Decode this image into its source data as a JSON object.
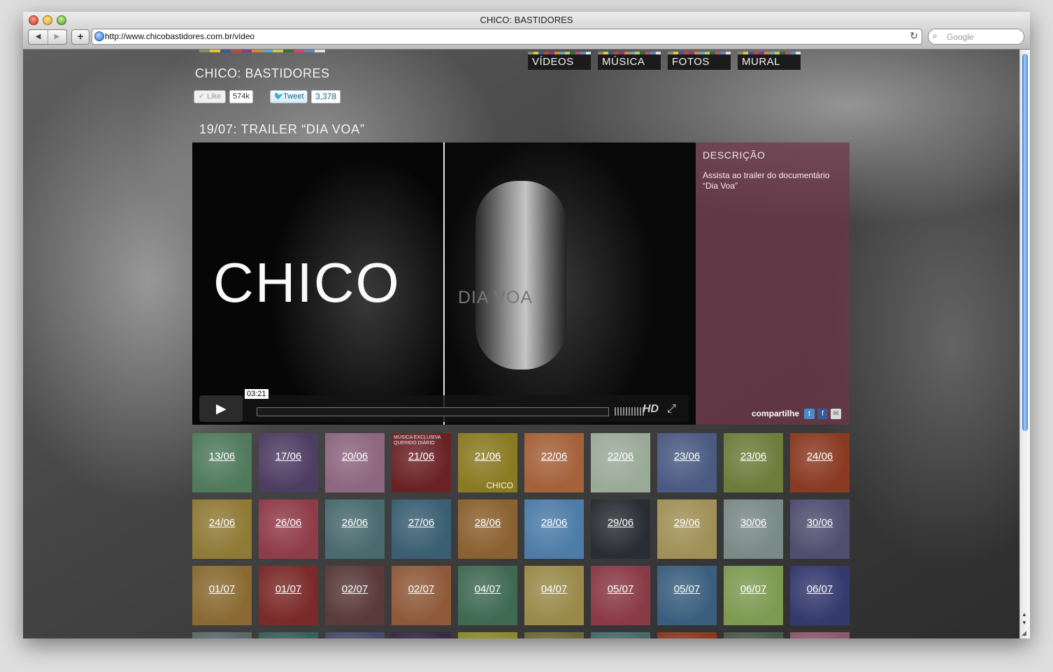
{
  "window": {
    "title": "CHICO: BASTIDORES"
  },
  "browser": {
    "url": "http://www.chicobastidores.com.br/video",
    "search_placeholder": "Google",
    "back": "◀",
    "forward": "▶",
    "add": "+",
    "reload": "↻",
    "search_icon": "⌕"
  },
  "site": {
    "title": "CHICO: BASTIDORES",
    "like_label": "✓ Like",
    "like_count": "574k",
    "tweet_label": "Tweet",
    "tweet_count": "3,378",
    "nav": [
      "VÍDEOS",
      "MÚSICA",
      "FOTOS",
      "MURAL"
    ],
    "colorbar": [
      "#8a8a6a",
      "#e6c430",
      "#3a5a9a",
      "#b84a3a",
      "#8a3a8a",
      "#d48a2a",
      "#6aa0c8",
      "#c8c84a",
      "#3a6a3a",
      "#c84a6a",
      "#5a8ab8",
      "#e0e0e0"
    ]
  },
  "video": {
    "title": "19/07: TRAILER “DIA VOA”",
    "overlay_title": "CHICO",
    "overlay_sub": "DIA VOA",
    "play_icon": "▶",
    "time": "03:21",
    "hd": "HD",
    "fullscreen_icon": "⤢"
  },
  "description": {
    "heading": "DESCRIÇÃO",
    "text": "Assista ao trailer do documentário “Dia Voa”",
    "share_label": "compartilhe",
    "share_icons": [
      "twitter-icon",
      "facebook-icon",
      "email-icon"
    ]
  },
  "tiles": [
    {
      "label": "13/06",
      "color": "#4f7a5c"
    },
    {
      "label": "17/06",
      "color": "#4e3d63"
    },
    {
      "label": "20/06",
      "color": "#8d6680"
    },
    {
      "label": "21/06",
      "color": "#6b2225",
      "sub": "MÚSICA EXCLUSIVA QUERIDO DIÁRIO"
    },
    {
      "label": "21/06",
      "color": "#8a7a22",
      "brand": "CHICO"
    },
    {
      "label": "22/06",
      "color": "#a5613a"
    },
    {
      "label": "22/06",
      "color": "#9aaa98"
    },
    {
      "label": "23/06",
      "color": "#4a5a82"
    },
    {
      "label": "23/06",
      "color": "#6f7c3c"
    },
    {
      "label": "24/06",
      "color": "#8a3a22"
    },
    {
      "label": "24/06",
      "color": "#8f7a36"
    },
    {
      "label": "26/06",
      "color": "#8f3c49"
    },
    {
      "label": "26/06",
      "color": "#4a6a6f"
    },
    {
      "label": "27/06",
      "color": "#3a5f72"
    },
    {
      "label": "28/06",
      "color": "#8a6130"
    },
    {
      "label": "28/06",
      "color": "#4d7ca8"
    },
    {
      "label": "29/06",
      "color": "#2a2d33"
    },
    {
      "label": "29/06",
      "color": "#a09058"
    },
    {
      "label": "30/06",
      "color": "#7a8a86"
    },
    {
      "label": "30/06",
      "color": "#4f4e6f"
    },
    {
      "label": "01/07",
      "color": "#8a6a32"
    },
    {
      "label": "01/07",
      "color": "#7a2a28"
    },
    {
      "label": "02/07",
      "color": "#5a3a3a"
    },
    {
      "label": "02/07",
      "color": "#8f5a3a"
    },
    {
      "label": "04/07",
      "color": "#3f6a52"
    },
    {
      "label": "04/07",
      "color": "#9a8a4a"
    },
    {
      "label": "05/07",
      "color": "#8a3a46"
    },
    {
      "label": "05/07",
      "color": "#3a5f7e"
    },
    {
      "label": "06/07",
      "color": "#7e9a52"
    },
    {
      "label": "06/07",
      "color": "#343a6e"
    },
    {
      "label": "",
      "color": "#5a6a6a"
    },
    {
      "label": "",
      "color": "#3d5f5a"
    },
    {
      "label": "",
      "color": "#4a4a6a"
    },
    {
      "label": "",
      "color": "#3a2a44"
    },
    {
      "label": "",
      "color": "#8a8a30"
    },
    {
      "label": "",
      "color": "#6a6a3a"
    },
    {
      "label": "",
      "color": "#4a6a6a"
    },
    {
      "label": "",
      "color": "#8a3a22"
    },
    {
      "label": "",
      "color": "#4a5a4a"
    },
    {
      "label": "",
      "color": "#8a5a6a"
    }
  ]
}
